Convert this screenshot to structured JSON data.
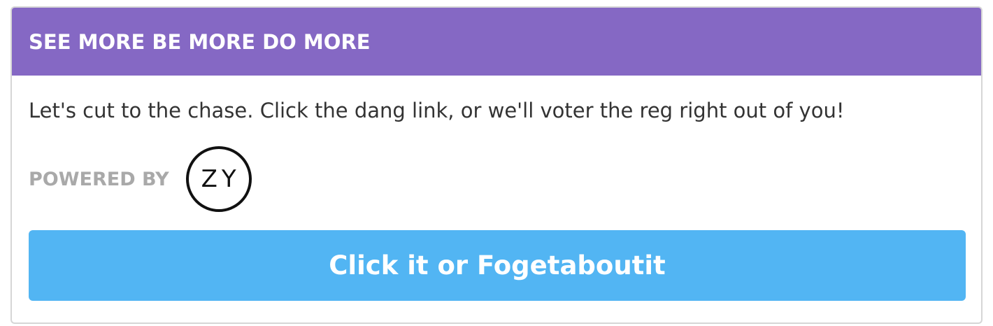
{
  "header": {
    "title": "SEE MORE BE MORE DO MORE"
  },
  "body": {
    "message": "Let's cut to the chase. Click the dang link, or we'll voter the reg right out of you!",
    "powered_by_label": "POWERED BY",
    "logo_text": "ZY"
  },
  "cta": {
    "label": "Click it or Fogetaboutit"
  },
  "colors": {
    "header_bg": "#8568c4",
    "button_bg": "#52b5f3",
    "muted_text": "#a9a9a9"
  }
}
